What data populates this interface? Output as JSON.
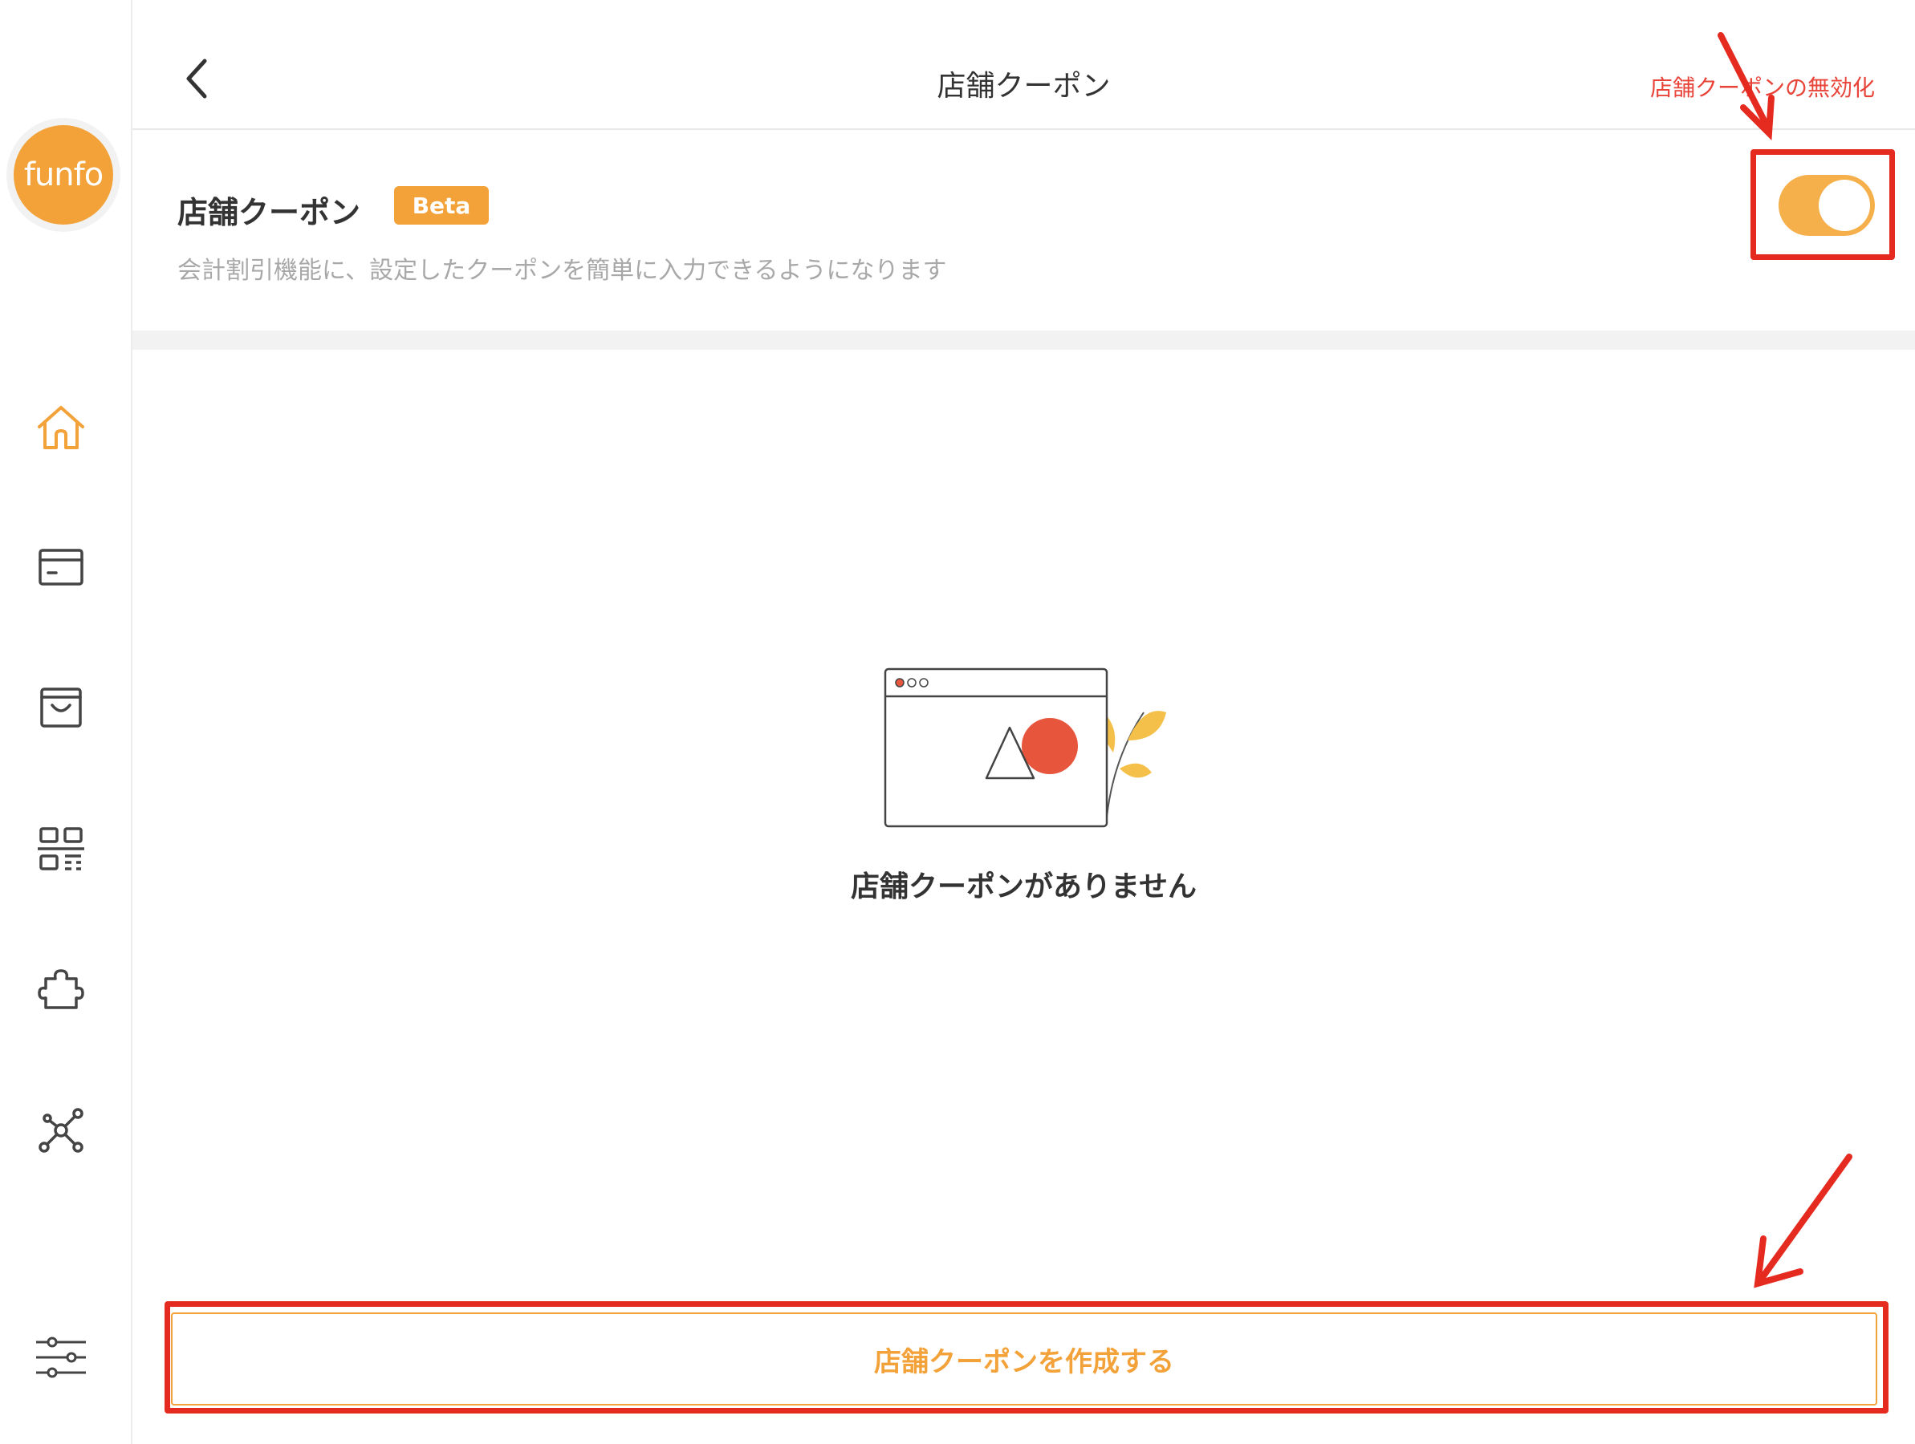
{
  "sidebar": {
    "logo_text": "funfo",
    "items": [
      {
        "icon": "home-icon",
        "active": true
      },
      {
        "icon": "card-icon",
        "active": false
      },
      {
        "icon": "shopping-bag-icon",
        "active": false
      },
      {
        "icon": "qr-code-icon",
        "active": false
      },
      {
        "icon": "puzzle-icon",
        "active": false
      },
      {
        "icon": "network-icon",
        "active": false
      },
      {
        "icon": "sliders-icon",
        "active": false
      }
    ]
  },
  "header": {
    "back_icon": "chevron-left-icon",
    "title": "店舗クーポン",
    "disable_link": "店舗クーポンの無効化"
  },
  "setting": {
    "title": "店舗クーポン",
    "badge": "Beta",
    "description": "会計割引機能に、設定したクーポンを簡単に入力できるようになります",
    "toggle_on": true
  },
  "empty_state": {
    "illustration_icon": "empty-window-illustration",
    "message": "店舗クーポンがありません"
  },
  "create_button": {
    "label": "店舗クーポンを作成する"
  },
  "colors": {
    "accent": "#f3a23a",
    "toggle": "#f5b04c",
    "annotation": "#e52a20",
    "muted_text": "#a8a8a8"
  }
}
